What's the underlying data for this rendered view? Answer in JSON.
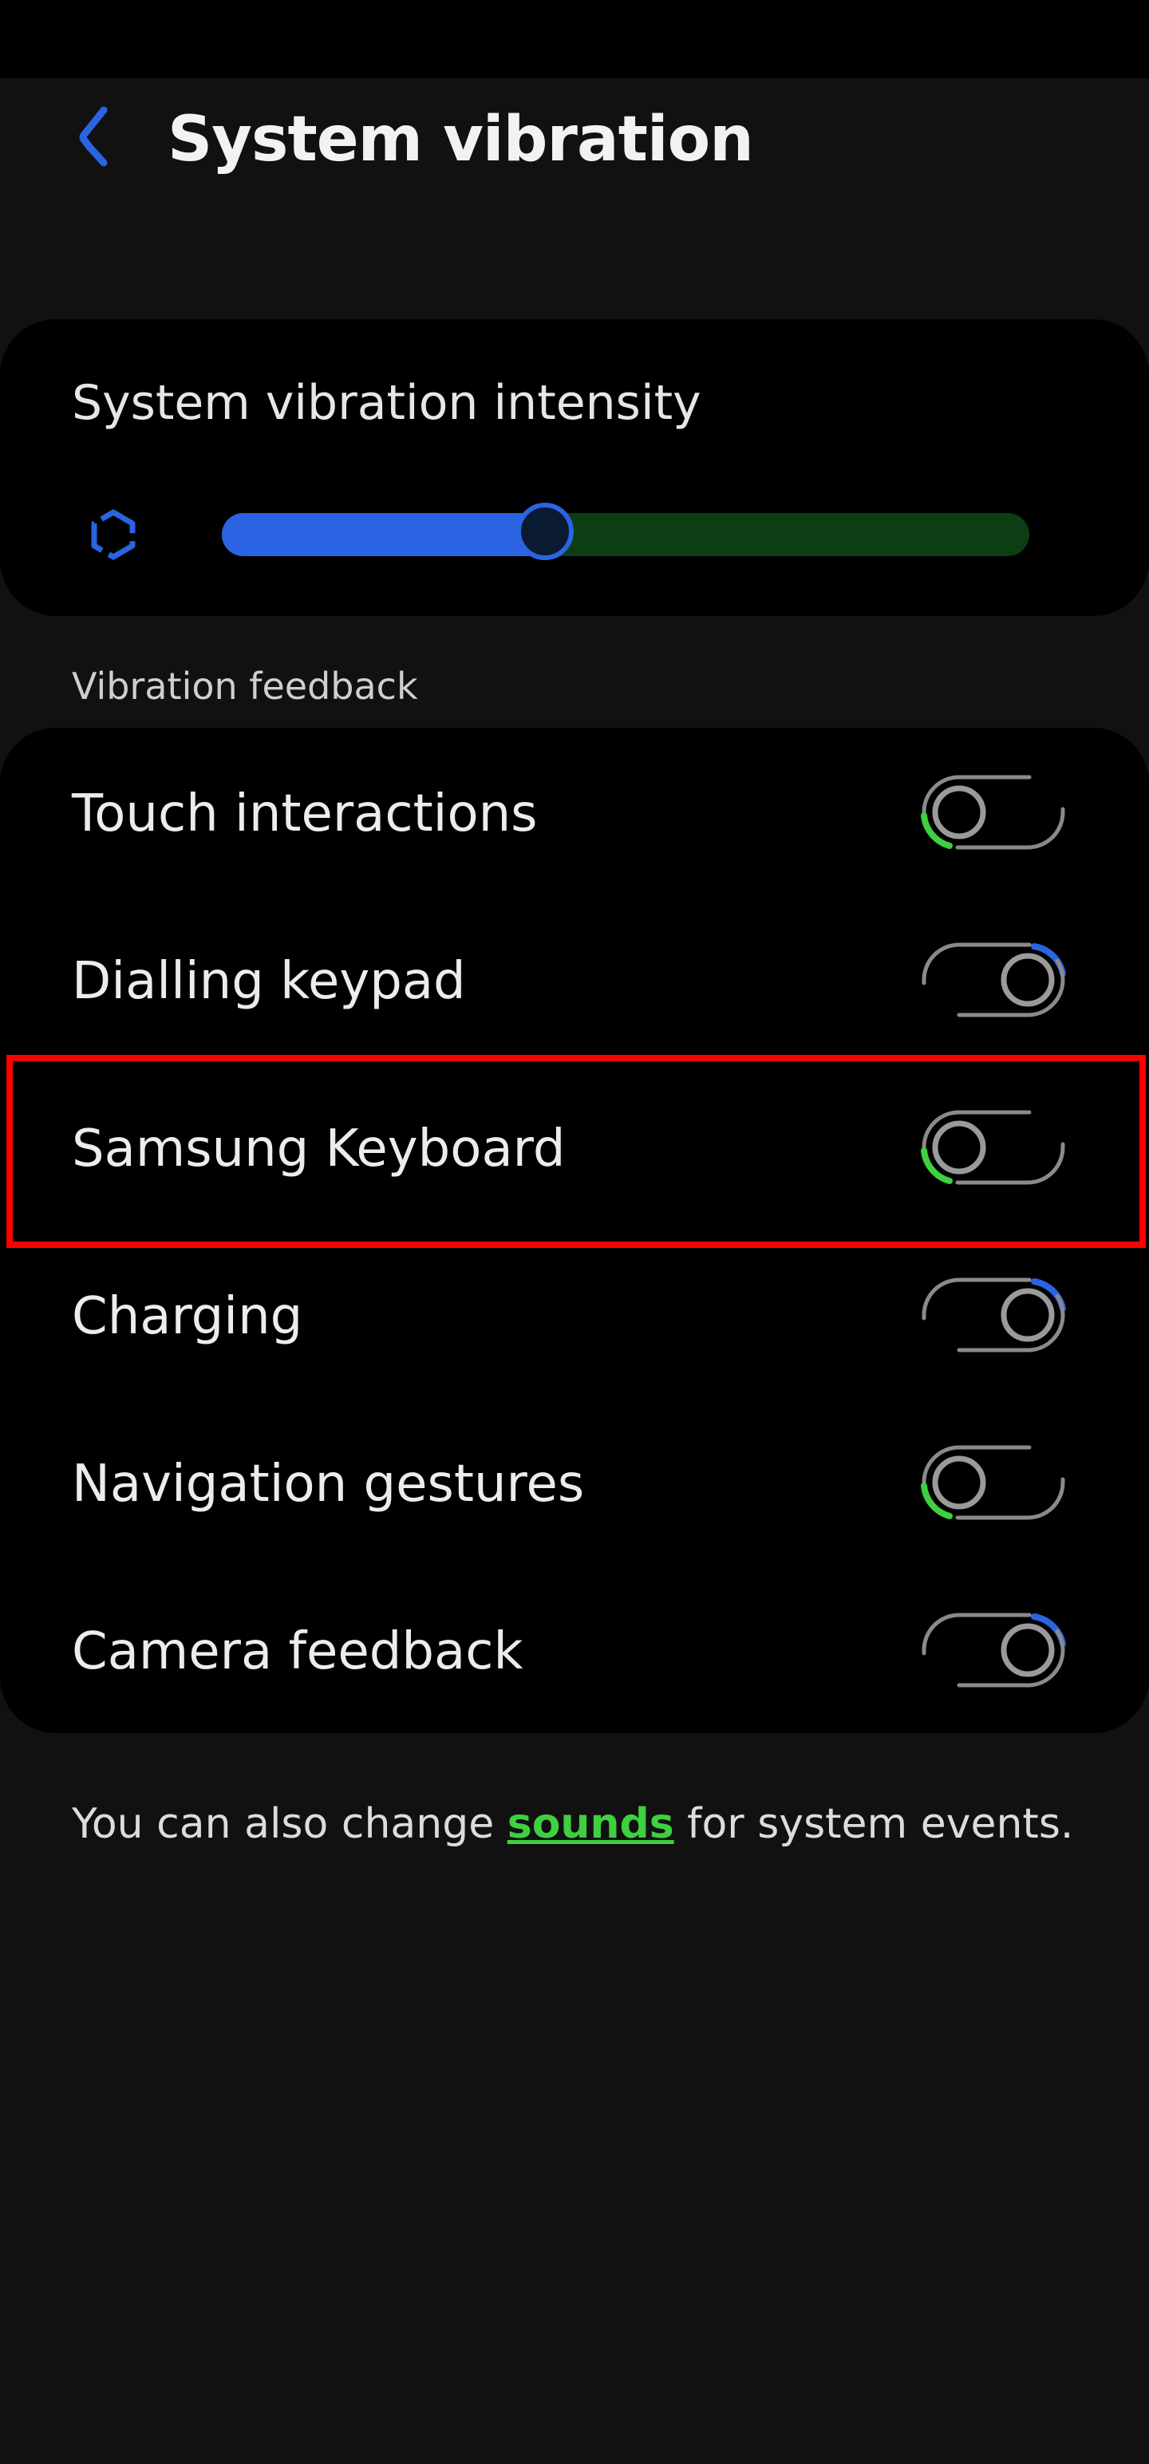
{
  "header": {
    "title": "System vibration"
  },
  "intensity": {
    "title": "System vibration intensity",
    "level": 0.4
  },
  "feedback": {
    "section_label": "Vibration feedback",
    "items": [
      {
        "label": "Touch interactions",
        "enabled": false
      },
      {
        "label": "Dialling keypad",
        "enabled": true
      },
      {
        "label": "Samsung Keyboard",
        "enabled": false
      },
      {
        "label": "Charging",
        "enabled": true
      },
      {
        "label": "Navigation gestures",
        "enabled": false
      },
      {
        "label": "Camera feedback",
        "enabled": true
      }
    ]
  },
  "footer": {
    "prefix": "You can also change ",
    "link": "sounds",
    "suffix": " for system events."
  },
  "colors": {
    "accent_blue": "#2a64e2",
    "accent_green": "#3fcf3f",
    "highlight_red": "#ff0000",
    "track_green": "#0d3d12"
  },
  "icons": {
    "back": "back-chevron-icon",
    "intensity": "vibration-hexagon-icon"
  }
}
